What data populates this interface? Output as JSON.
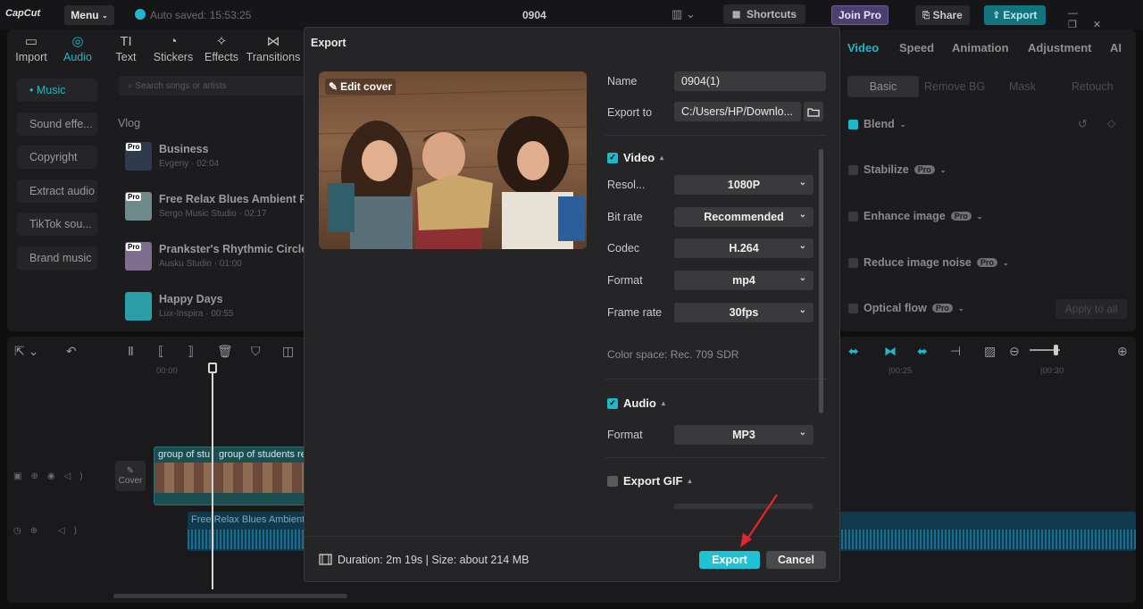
{
  "app": {
    "logo": "CapCut",
    "menu_label": "Menu",
    "autosave": "Auto saved: 15:53:25",
    "project_title": "0904",
    "shortcuts": "Shortcuts",
    "join_pro": "Join Pro",
    "share": "Share",
    "export": "Export"
  },
  "toolbar": [
    {
      "label": "Import",
      "icon": "import-icon",
      "glyph": "▭"
    },
    {
      "label": "Audio",
      "icon": "audio-icon",
      "glyph": "◎"
    },
    {
      "label": "Text",
      "icon": "text-icon",
      "glyph": "TI"
    },
    {
      "label": "Stickers",
      "icon": "stickers-icon",
      "glyph": "◔"
    },
    {
      "label": "Effects",
      "icon": "effects-icon",
      "glyph": "✧"
    },
    {
      "label": "Transitions",
      "icon": "transitions-icon",
      "glyph": "⋈"
    }
  ],
  "sidebar": [
    "• Music",
    "Sound effe...",
    "Copyright",
    "Extract audio",
    "TikTok sou...",
    "Brand music"
  ],
  "search": {
    "placeholder": "Search songs or artists"
  },
  "library": {
    "category": "Vlog",
    "tracks": [
      {
        "title": "Business",
        "sub": "Evgeny · 02:04",
        "badge": "Pro"
      },
      {
        "title": "Free Relax Blues Ambient Po",
        "sub": "Sergo Music Studio · 02:17",
        "badge": "Pro"
      },
      {
        "title": "Prankster's Rhythmic Circles",
        "sub": "Ausku Studio · 01:00",
        "badge": "Pro"
      },
      {
        "title": "Happy Days",
        "sub": "Lux-Inspira · 00:55",
        "badge": ""
      }
    ]
  },
  "right": {
    "tabs": [
      "Video",
      "Speed",
      "Animation",
      "Adjustment",
      "AI"
    ],
    "subtabs": [
      "Basic",
      "Remove BG",
      "Mask",
      "Retouch"
    ],
    "options": [
      {
        "label": "Blend",
        "pro": ""
      },
      {
        "label": "Stabilize",
        "pro": "Pro"
      },
      {
        "label": "Enhance image",
        "pro": "Pro"
      },
      {
        "label": "Reduce image noise",
        "pro": "Pro"
      },
      {
        "label": "Optical flow",
        "pro": "Pro"
      }
    ],
    "apply_all": "Apply to all"
  },
  "timeline": {
    "ticks": [
      "00:00",
      "|00:25",
      "|00:30"
    ],
    "cover": "Cover",
    "clip1": "group of stu",
    "clip2": "group of students re",
    "audio": "Free Relax Blues Ambient"
  },
  "modal": {
    "title": "Export",
    "edit_cover": "Edit cover",
    "name_label": "Name",
    "name_value": "0904(1)",
    "export_to_label": "Export to",
    "export_to_value": "C:/Users/HP/Downlo...",
    "video_section": "Video",
    "resolution_label": "Resol...",
    "resolution": "1080P",
    "bitrate_label": "Bit rate",
    "bitrate": "Recommended",
    "codec_label": "Codec",
    "codec": "H.264",
    "format_label": "Format",
    "format": "mp4",
    "framerate_label": "Frame rate",
    "framerate": "30fps",
    "colorspace": "Color space: Rec. 709 SDR",
    "audio_section": "Audio",
    "audio_format_label": "Format",
    "audio_format": "MP3",
    "gif_section": "Export GIF",
    "duration_size": "Duration: 2m 19s | Size: about 214 MB",
    "export_button": "Export",
    "cancel_button": "Cancel"
  },
  "colors": {
    "accent": "#1fb8c8",
    "arrow": "#e3262b"
  }
}
